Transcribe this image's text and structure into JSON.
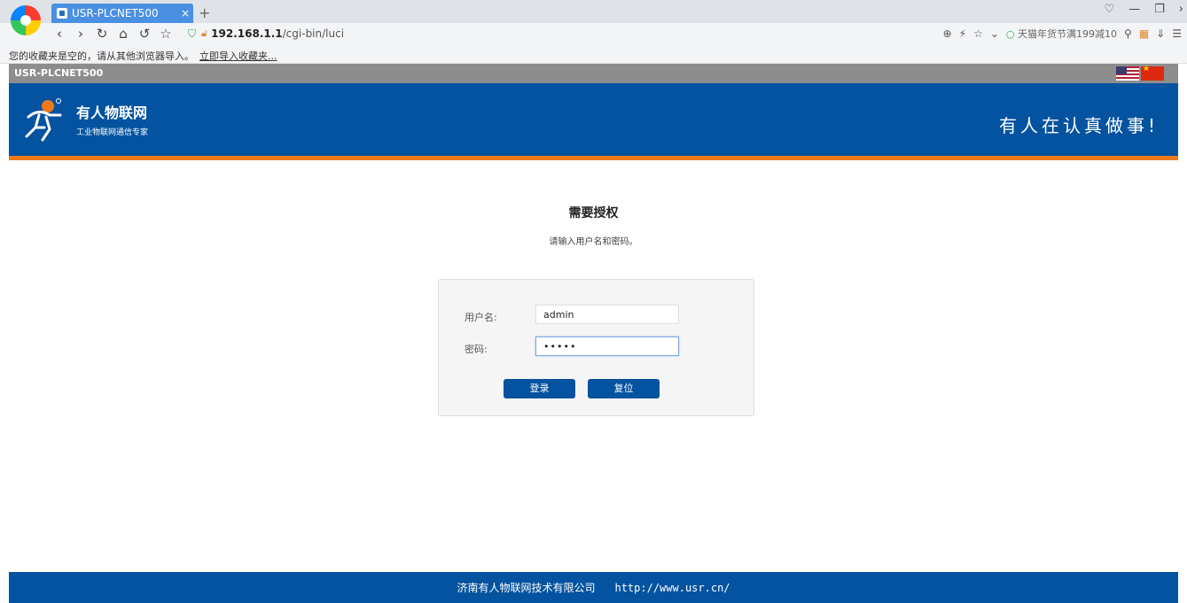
{
  "browser": {
    "tab_title": "USR-PLCNET500",
    "tab_close": "×",
    "new_tab": "+",
    "url_host": "192.168.1.1",
    "url_path": "/cgi-bin/luci",
    "promo_text": "天猫年货节满199减10",
    "bookmark_notice": "您的收藏夹是空的，请从其他浏览器导入。",
    "bookmark_import_link": "立即导入收藏夹..."
  },
  "page": {
    "product_name": "USR-PLCNET500",
    "brand_name": "有人物联网",
    "brand_tagline": "工业物联网通信专家",
    "slogan": "有人在认真做事!",
    "auth_title": "需要授权",
    "auth_subtitle": "请输入用户名和密码。",
    "username_label": "用户名:",
    "username_value": "admin",
    "password_label": "密码:",
    "password_value": "•••••",
    "login_label": "登录",
    "reset_label": "复位",
    "footer_company": "济南有人物联网技术有限公司",
    "footer_url": "http://www.usr.cn/"
  },
  "colors": {
    "brand_blue": "#0453a0",
    "accent_orange": "#ef7a1a",
    "topbar_gray": "#8d8d8d"
  }
}
